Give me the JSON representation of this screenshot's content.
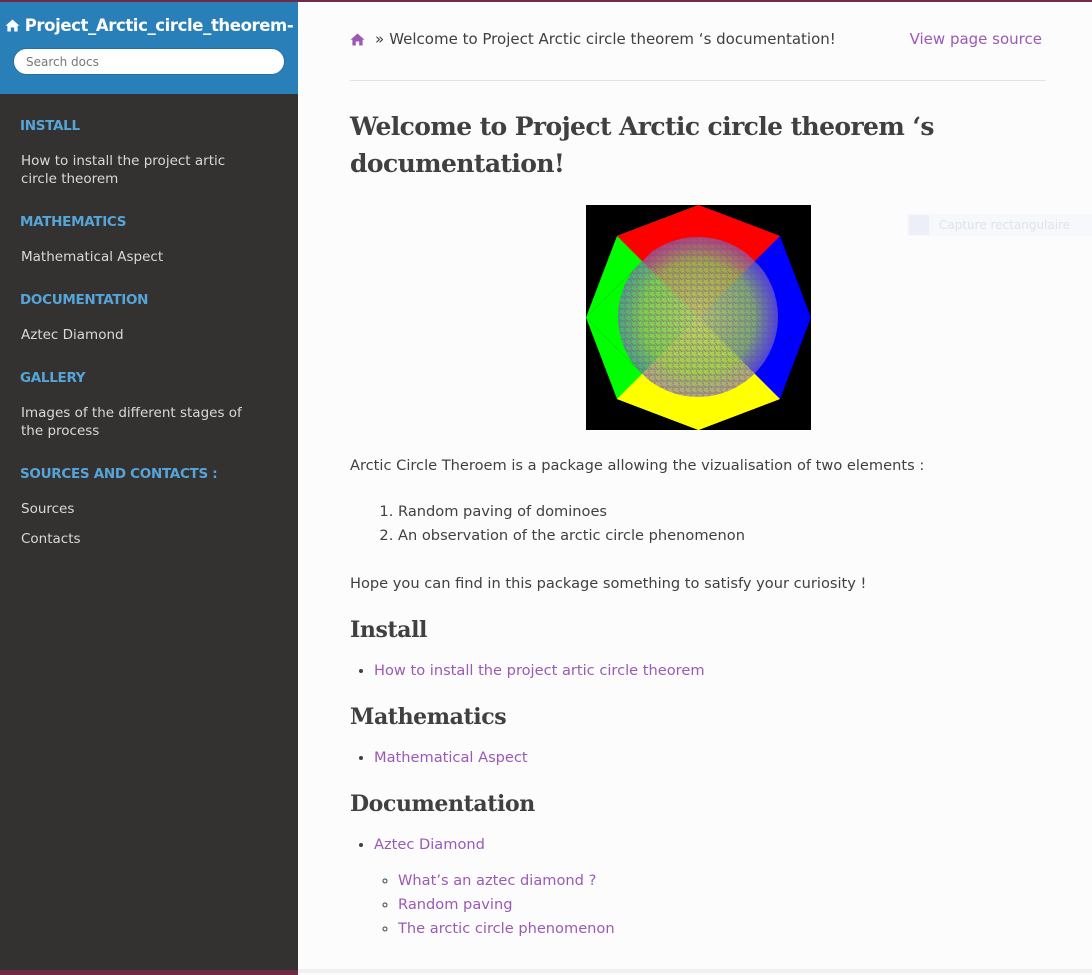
{
  "sidebar": {
    "project_title": "Project_Arctic_circle_theorem-",
    "search_placeholder": "Search docs",
    "sections": [
      {
        "caption": "INSTALL",
        "items": [
          "How to install the project artic circle theorem"
        ]
      },
      {
        "caption": "MATHEMATICS",
        "items": [
          "Mathematical Aspect"
        ]
      },
      {
        "caption": "DOCUMENTATION",
        "items": [
          "Aztec Diamond"
        ]
      },
      {
        "caption": "GALLERY",
        "items": [
          "Images of the different stages of the process"
        ]
      },
      {
        "caption": "SOURCES AND CONTACTS :",
        "items": [
          "Sources",
          "Contacts"
        ]
      }
    ]
  },
  "breadcrumb": {
    "separator": "»",
    "current": "Welcome to Project Arctic circle theorem ‘s documentation!",
    "view_source": "View page source"
  },
  "main": {
    "title": "Welcome to Project Arctic circle theorem ‘s documentation!",
    "intro": "Arctic Circle Theroem is a package allowing the vizualisation of two elements :",
    "elements": [
      "Random paving of dominoes",
      "An observation of the arctic circle phenomenon"
    ],
    "hope": "Hope you can find in this package something to satisfy your curiosity !",
    "sections": [
      {
        "heading": "Install",
        "links": [
          "How to install the project artic circle theorem"
        ]
      },
      {
        "heading": "Mathematics",
        "links": [
          "Mathematical Aspect"
        ]
      },
      {
        "heading": "Documentation",
        "links": [
          "Aztec Diamond"
        ],
        "sublinks": [
          "What’s an aztec diamond ?",
          "Random paving",
          "The arctic circle phenomenon"
        ]
      }
    ]
  },
  "overlay": {
    "capture_label": "Capture rectangulaire"
  },
  "colors": {
    "sidebar_bg": "#343131",
    "header_bg": "#2980b9",
    "caption": "#55a5d9",
    "link": "#9b59b6",
    "diamond_top": "#ff0000",
    "diamond_right": "#0000ff",
    "diamond_bottom": "#ffff00",
    "diamond_left": "#00ff00"
  }
}
